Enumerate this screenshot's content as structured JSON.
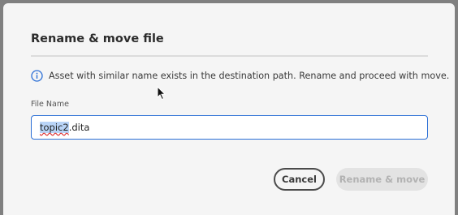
{
  "dialog": {
    "title": "Rename & move file",
    "info_icon": "info-circle-icon",
    "info_text": "Asset with similar name exists in the destination path. Rename and proceed with move.",
    "field_label": "File Name",
    "input_value": "topic2.dita",
    "input_selected_part": "topic2",
    "input_rest": ".dita",
    "cancel_label": "Cancel",
    "rename_move_label": "Rename & move",
    "rename_move_disabled": true
  },
  "colors": {
    "accent": "#2b6fd6",
    "selection": "#b9d4f7",
    "disabled_text": "#b2b2b2"
  }
}
